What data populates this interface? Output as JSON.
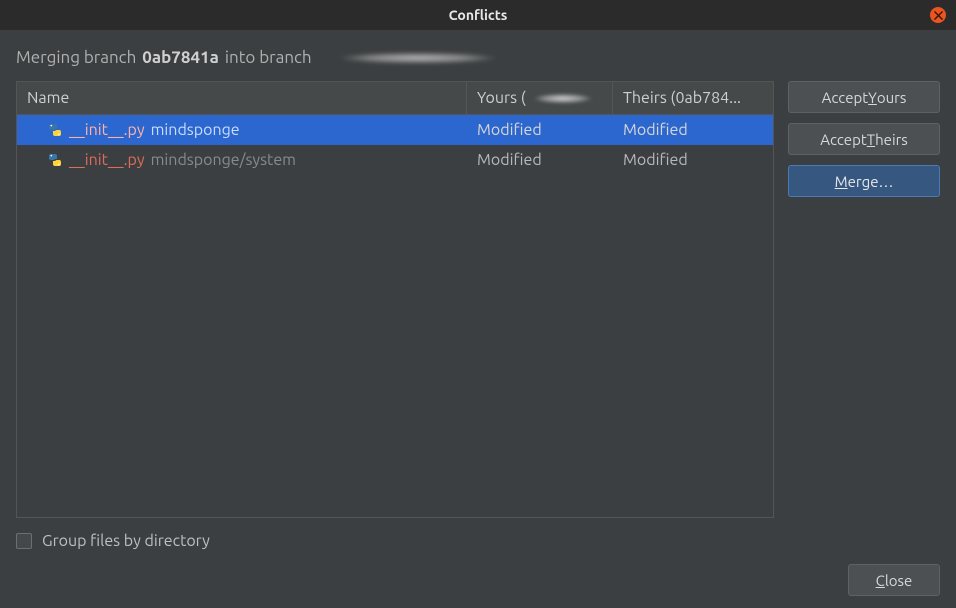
{
  "window": {
    "title": "Conflicts"
  },
  "merge_line": {
    "prefix": "Merging branch",
    "branch_from": "0ab7841a",
    "mid": "into branch"
  },
  "table": {
    "headers": {
      "name": "Name",
      "yours_prefix": "Yours (",
      "theirs": "Theirs (0ab784..."
    },
    "rows": [
      {
        "file": "__init__.py",
        "path": "mindsponge",
        "yours": "Modified",
        "theirs": "Modified",
        "selected": true
      },
      {
        "file": "__init__.py",
        "path": "mindsponge/system",
        "yours": "Modified",
        "theirs": "Modified",
        "selected": false
      }
    ]
  },
  "buttons": {
    "accept_yours_pre": "Accept ",
    "accept_yours_u": "Y",
    "accept_yours_post": "ours",
    "accept_theirs_pre": "Accept ",
    "accept_theirs_u": "T",
    "accept_theirs_post": "heirs",
    "merge_u": "M",
    "merge_post": "erge…",
    "close_u": "C",
    "close_post": "lose"
  },
  "checkbox": {
    "label": "Group files by directory"
  }
}
